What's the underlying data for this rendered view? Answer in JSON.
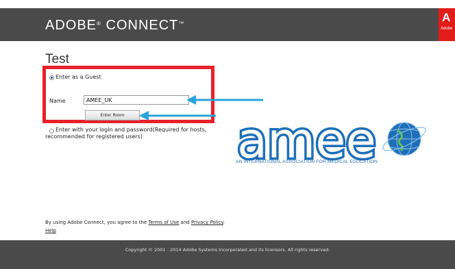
{
  "header": {
    "brand": "ADOBE",
    "brand_reg": "®",
    "brand_product": " CONNECT",
    "brand_tm": "™",
    "adobe_logo_letter": "A",
    "adobe_logo_text": "Adobe"
  },
  "page": {
    "title": "Test"
  },
  "guest": {
    "radio_label": "Enter as a Guest",
    "name_label": "Name",
    "name_value": "AMEE_UK",
    "enter_room_label": "Enter Room"
  },
  "login": {
    "radio_label": "Enter with your login and password(Required for hosts, recommended for registered users)"
  },
  "amee": {
    "wordmark": "amee",
    "tagline": "AN INTERNATIONAL ASSOCIATION FOR MEDICAL EDUCATION"
  },
  "legal": {
    "prefix": "By using Adobe Connect, you agree to the ",
    "terms": "Terms of Use",
    "and": " and ",
    "privacy": "Privacy Policy",
    "suffix": ".",
    "help": "Help"
  },
  "footer": {
    "copyright": "Copyright © 2001 - 2014 Adobe Systems Incorporated and its licensors. All rights reserved."
  },
  "colors": {
    "header_bg": "#4a4a4a",
    "highlight_box": "#e8202a",
    "annotation_arrow": "#29a3dc",
    "amee_blue": "#1f6fb8",
    "adobe_red": "#e21c18"
  }
}
